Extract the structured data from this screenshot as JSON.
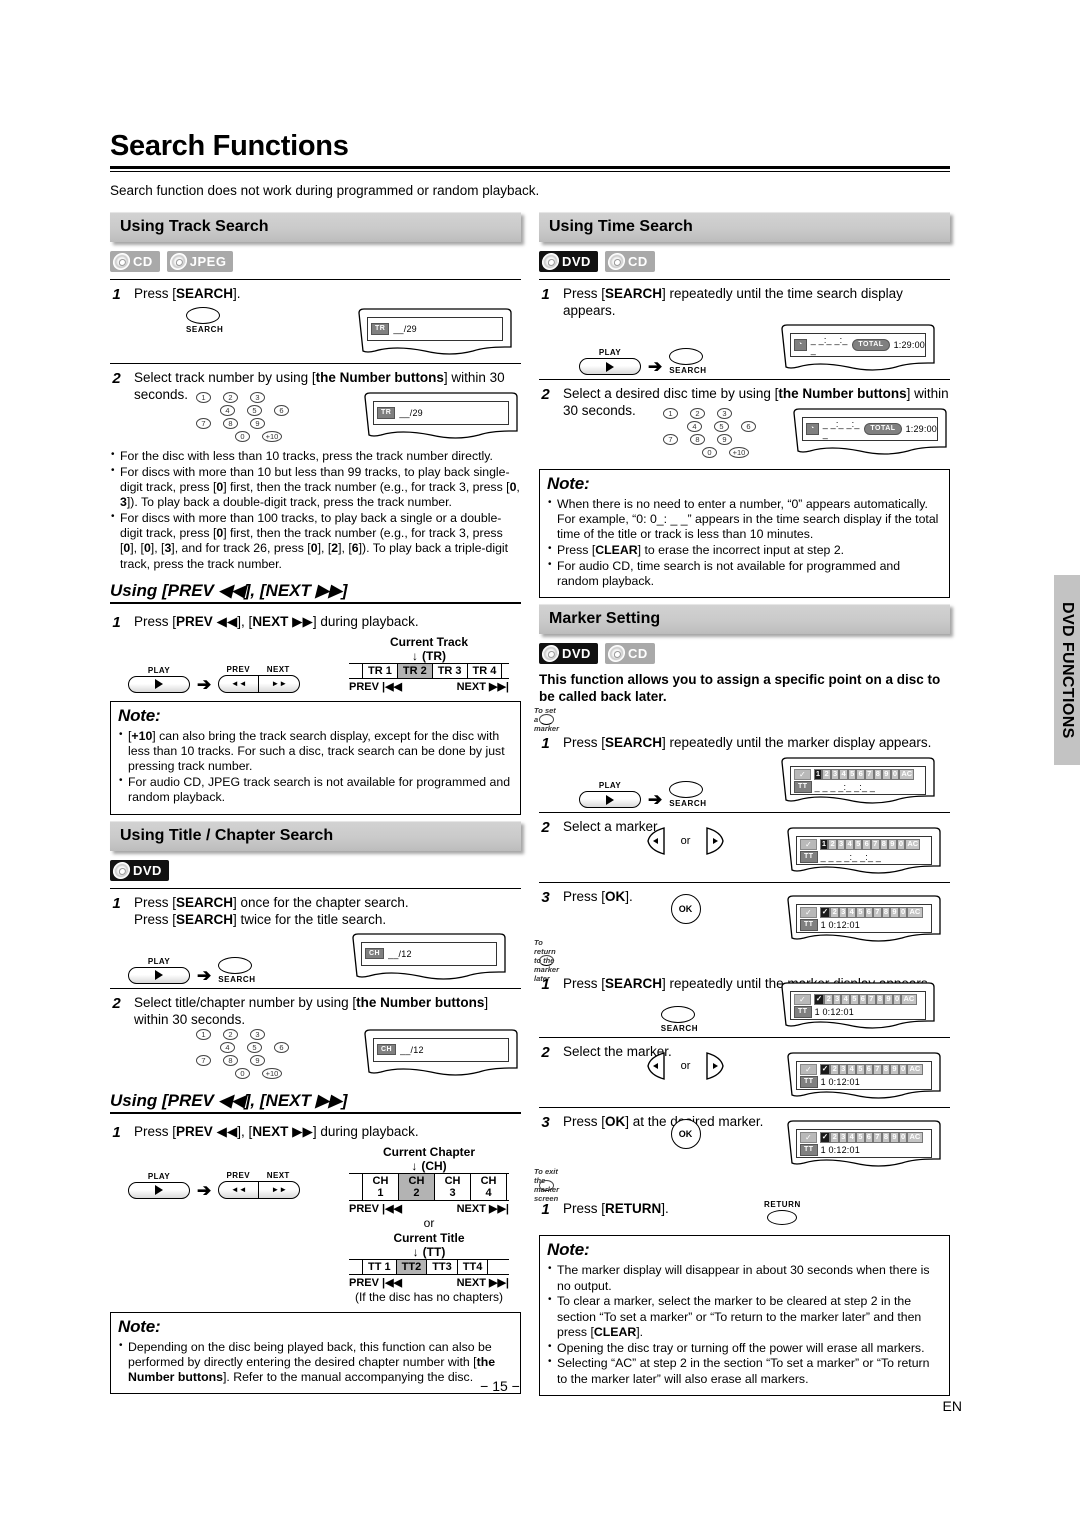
{
  "page": {
    "title": "Search Functions",
    "intro": "Search function does not work during programmed or random playback.",
    "number": "− 15 −",
    "language": "EN",
    "side_tab": "DVD FUNCTIONS"
  },
  "icons": {
    "disc": "disc-icon",
    "arrow": "➔",
    "play_triangle": "play-triangle-icon",
    "prev_glyph": "◀◀",
    "next_glyph": "▶▶",
    "clock": "◔"
  },
  "left_column": {
    "track_search": {
      "heading": "Using Track Search",
      "badges": [
        {
          "label": "CD",
          "style": "gray"
        },
        {
          "label": "JPEG",
          "style": "gray"
        }
      ],
      "steps": [
        {
          "num": "1",
          "text_html": "Press [<b>SEARCH</b>].",
          "button_caption": "SEARCH",
          "display": {
            "tag": "TR",
            "value": "__/29"
          }
        },
        {
          "num": "2",
          "text_html": "Select track number by using [<b>the Number buttons</b>] within 30 seconds.",
          "display": {
            "tag": "TR",
            "value": "__/29"
          }
        }
      ],
      "numpad": [
        "1",
        "2",
        "3",
        "4",
        "5",
        "6",
        "7",
        "8",
        "9",
        "0",
        "+10"
      ],
      "bullets_html": [
        "For the disc with less than 10 tracks, press the track number directly.",
        "For discs with more than 10 but less than 99 tracks, to play back single-digit track, press [<b>0</b>] first, then the track number (e.g., for track 3, press [<b>0</b>, <b>3</b>]). To play back a double-digit track, press the track number.",
        "For discs with more than 100 tracks, to play back a single or a double-digit track, press [<b>0</b>] first, then the track number (e.g., for track 3, press [<b>0</b>], [<b>0</b>], [<b>3</b>], and for track 26, press [<b>0</b>], [<b>2</b>], [<b>6</b>]). To play back a triple-digit track, press the track number."
      ]
    },
    "prev_next_track": {
      "heading": "Using [PREV ◀◀], [NEXT ▶▶]",
      "step": {
        "num": "1",
        "text_html": "Press [<b>PREV</b> ◀◀], [<b>NEXT</b> ▶▶] during playback."
      },
      "play_label": "PLAY",
      "prev_label": "PREV",
      "next_label": "NEXT",
      "diagram": {
        "current_label": "Current Track",
        "current_abbr": "(TR)",
        "cells": [
          "TR 1",
          "TR 2",
          "TR 3",
          "TR 4"
        ],
        "selected_index": 1,
        "prev_text": "PREV |◀◀",
        "next_text": "NEXT ▶▶|"
      },
      "note": {
        "title": "Note:",
        "bullets_html": [
          "[<b>+10</b>] can also bring the track search display, except for the disc with less than 10 tracks. For such a disc, track search can be done by just pressing track number.",
          "For audio CD, JPEG track search is not available for programmed and random playback."
        ]
      }
    },
    "title_chapter_search": {
      "heading": "Using Title / Chapter Search",
      "badges": [
        {
          "label": "DVD",
          "style": "dark"
        }
      ],
      "steps": [
        {
          "num": "1",
          "text_html": "Press [<b>SEARCH</b>] once for the chapter search.<br>Press [<b>SEARCH</b>] twice for the title search.",
          "play_label": "PLAY",
          "button_caption": "SEARCH",
          "display": {
            "tag": "CH",
            "value": "__/12"
          }
        },
        {
          "num": "2",
          "text_html": "Select title/chapter number by using [<b>the Number buttons</b>] within 30 seconds.",
          "display": {
            "tag": "CH",
            "value": "__/12"
          }
        }
      ],
      "numpad": [
        "1",
        "2",
        "3",
        "4",
        "5",
        "6",
        "7",
        "8",
        "9",
        "0",
        "+10"
      ]
    },
    "prev_next_chapter": {
      "heading": "Using [PREV ◀◀], [NEXT ▶▶]",
      "step": {
        "num": "1",
        "text_html": "Press [<b>PREV</b> ◀◀], [<b>NEXT</b> ▶▶] during playback."
      },
      "play_label": "PLAY",
      "prev_label": "PREV",
      "next_label": "NEXT",
      "chapter_diagram": {
        "current_label": "Current Chapter",
        "current_abbr": "(CH)",
        "cells": [
          "CH 1",
          "CH 2",
          "CH 3",
          "CH 4"
        ],
        "selected_index": 1,
        "prev_text": "PREV |◀◀",
        "next_text": "NEXT ▶▶|"
      },
      "or_text": "or",
      "title_diagram": {
        "current_label": "Current Title",
        "current_abbr": "(TT)",
        "cells": [
          "TT 1",
          "TT2",
          "TT3",
          "TT4"
        ],
        "selected_index": 1,
        "prev_text": "PREV |◀◀",
        "next_text": "NEXT ▶▶|"
      },
      "footnote": "(If the disc has no chapters)",
      "note": {
        "title": "Note:",
        "bullets_html": [
          "Depending on the disc being played back, this function can also be performed by directly entering the desired chapter number with [<b>the Number buttons</b>]. Refer to the manual accompanying the disc."
        ]
      }
    }
  },
  "right_column": {
    "time_search": {
      "heading": "Using Time Search",
      "badges": [
        {
          "label": "DVD",
          "style": "dark"
        },
        {
          "label": "CD",
          "style": "gray"
        }
      ],
      "steps": [
        {
          "num": "1",
          "text_html": "Press [<b>SEARCH</b>] repeatedly until the time search display appears.",
          "play_label": "PLAY",
          "button_caption": "SEARCH",
          "display": {
            "dashes": "_ _:_ _:_ _",
            "total_tag": "TOTAL",
            "time": "1:29:00"
          }
        },
        {
          "num": "2",
          "text_html": "Select a desired disc time by using [<b>the Number buttons</b>] within 30 seconds.",
          "display": {
            "dashes": "_ _:_ _:_ _",
            "total_tag": "TOTAL",
            "time": "1:29:00"
          }
        }
      ],
      "numpad": [
        "1",
        "2",
        "3",
        "4",
        "5",
        "6",
        "7",
        "8",
        "9",
        "0",
        "+10"
      ],
      "note": {
        "title": "Note:",
        "bullets_html": [
          "When there is no need to enter a number, “0” appears automatically. For example, “0: 0_: _ _” appears in the time search display if the total time of the title or track is less than 10 minutes.",
          "Press [<b>CLEAR</b>] to erase the incorrect input at step 2.",
          "For audio CD, time search is not available for programmed and random playback."
        ]
      }
    },
    "marker_setting": {
      "heading": "Marker Setting",
      "badges": [
        {
          "label": "DVD",
          "style": "dark"
        },
        {
          "label": "CD",
          "style": "gray"
        }
      ],
      "description": "This function allows you to assign a specific point on a disc to be called back later.",
      "set_marker": {
        "heading": "To set a marker",
        "steps": [
          {
            "num": "1",
            "text_html": "Press [<b>SEARCH</b>] repeatedly until the marker display appears.",
            "play_label": "PLAY",
            "button_caption": "SEARCH",
            "display": {
              "markers": [
                "1",
                "2",
                "3",
                "4",
                "5",
                "6",
                "7",
                "8",
                "9",
                "0",
                "AC"
              ],
              "active_index": 0,
              "checked": [],
              "tag": "TT",
              "value": "_ _ _ _:_ _:_ _"
            }
          },
          {
            "num": "2",
            "text_html": "Select a marker.",
            "control": "left-right-arrows",
            "or_text": "or",
            "display": {
              "markers": [
                "1",
                "2",
                "3",
                "4",
                "5",
                "6",
                "7",
                "8",
                "9",
                "0",
                "AC"
              ],
              "active_index": 0,
              "checked": [],
              "tag": "TT",
              "value": "_ _ _ _:_ _:_ _"
            }
          },
          {
            "num": "3",
            "text_html": "Press [<b>OK</b>].",
            "control": "ok-button",
            "ok_label": "OK",
            "display": {
              "markers": [
                "1",
                "2",
                "3",
                "4",
                "5",
                "6",
                "7",
                "8",
                "9",
                "0",
                "AC"
              ],
              "active_index": 0,
              "checked": [
                0
              ],
              "tag": "TT",
              "value": "1  0:12:01"
            }
          }
        ]
      },
      "return_marker": {
        "heading": "To return to the marker later",
        "steps": [
          {
            "num": "1",
            "text_html": "Press [<b>SEARCH</b>] repeatedly until the marker display appears.",
            "button_caption": "SEARCH",
            "display": {
              "markers": [
                "1",
                "2",
                "3",
                "4",
                "5",
                "6",
                "7",
                "8",
                "9",
                "0",
                "AC"
              ],
              "active_index": 0,
              "checked": [
                0
              ],
              "tag": "TT",
              "value": "1  0:12:01"
            }
          },
          {
            "num": "2",
            "text_html": "Select the marker.",
            "control": "left-right-arrows",
            "or_text": "or",
            "display": {
              "markers": [
                "1",
                "2",
                "3",
                "4",
                "5",
                "6",
                "7",
                "8",
                "9",
                "0",
                "AC"
              ],
              "active_index": 0,
              "checked": [
                0
              ],
              "tag": "TT",
              "value": "1  0:12:01"
            }
          },
          {
            "num": "3",
            "text_html": "Press [<b>OK</b>] at the desired marker.",
            "control": "ok-button",
            "ok_label": "OK",
            "display": {
              "markers": [
                "1",
                "2",
                "3",
                "4",
                "5",
                "6",
                "7",
                "8",
                "9",
                "0",
                "AC"
              ],
              "active_index": 0,
              "checked": [
                0
              ],
              "tag": "TT",
              "value": "1  0:12:01"
            }
          }
        ]
      },
      "exit_marker": {
        "heading": "To exit the marker screen",
        "step": {
          "num": "1",
          "text_html": "Press [<b>RETURN</b>].",
          "button_caption": "RETURN"
        },
        "note": {
          "title": "Note:",
          "bullets_html": [
            "The marker display will disappear in about 30 seconds when there is no output.",
            "To clear a marker, select the marker to be cleared at step 2 in the section “To set a marker” or “To return to the marker later” and then press [<b>CLEAR</b>].",
            "Opening the disc tray or turning off the power will erase all markers.",
            "Selecting “AC” at step 2 in the section “To set a marker” or “To return to the marker later” will also erase all markers."
          ]
        }
      }
    }
  }
}
